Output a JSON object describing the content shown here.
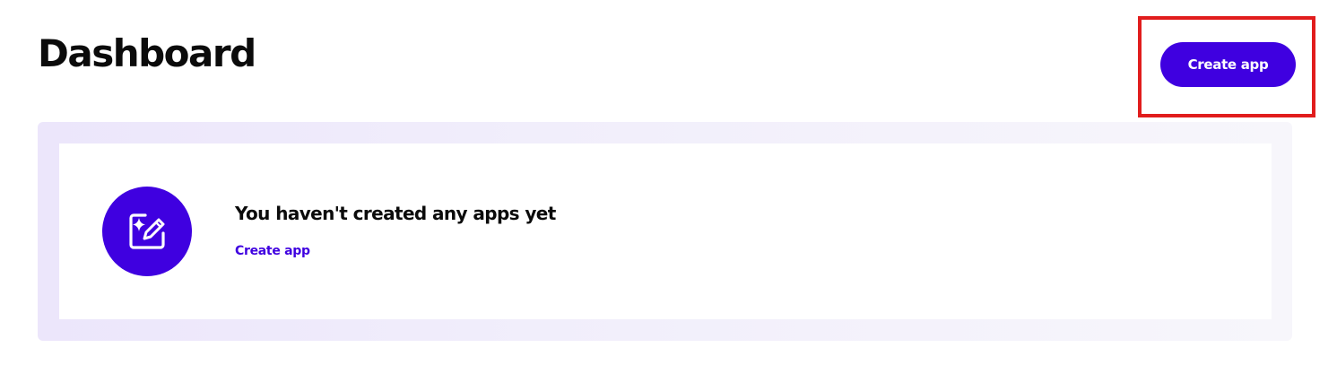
{
  "header": {
    "title": "Dashboard",
    "create_button_label": "Create app"
  },
  "empty_state": {
    "icon": "edit-sparkle-icon",
    "title": "You haven't created any apps yet",
    "link_label": "Create app"
  },
  "colors": {
    "accent": "#3f00e0",
    "highlight": "#e11d1d",
    "panel_bg": "#ece6fb",
    "text": "#0b0b0b"
  }
}
